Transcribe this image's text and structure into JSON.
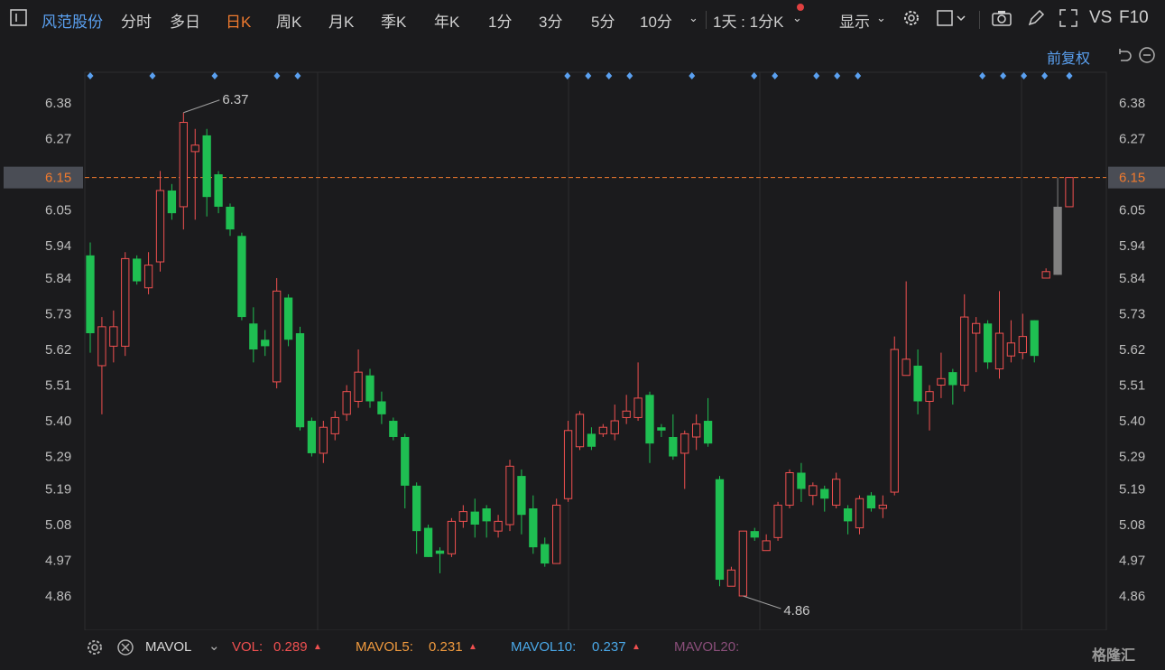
{
  "toolbar": {
    "stock_name": "风范股份",
    "periods": [
      "分时",
      "多日",
      "日K",
      "周K",
      "月K",
      "季K",
      "年K",
      "1分",
      "3分",
      "5分",
      "10分"
    ],
    "active_period": "日K",
    "multi_label": "1天 : 1分K",
    "display_label": "显示",
    "vs_label": "VS",
    "f10_label": "F10"
  },
  "adjust_label": "前复权",
  "colors": {
    "up": "#f05050",
    "down": "#1fbf52",
    "bg": "#1b1b1d",
    "grid": "#2c2c2e",
    "accent": "#f07a2e",
    "blue": "#5aa0f0"
  },
  "chart_data": {
    "type": "candlestick",
    "ylim": [
      4.8,
      6.44
    ],
    "yticks": [
      "6.38",
      "6.27",
      "6.15",
      "6.05",
      "5.94",
      "5.84",
      "5.73",
      "5.62",
      "5.51",
      "5.40",
      "5.29",
      "5.19",
      "5.08",
      "4.97",
      "4.86"
    ],
    "last_price": "6.15",
    "max_label": "6.37",
    "min_label": "4.86",
    "candles": [
      [
        5.91,
        5.67,
        5.95,
        5.61
      ],
      [
        5.57,
        5.69,
        5.72,
        5.42
      ],
      [
        5.63,
        5.69,
        5.74,
        5.58
      ],
      [
        5.63,
        5.9,
        5.92,
        5.6
      ],
      [
        5.9,
        5.83,
        5.91,
        5.82
      ],
      [
        5.81,
        5.88,
        5.92,
        5.79
      ],
      [
        5.89,
        6.11,
        6.17,
        5.86
      ],
      [
        6.11,
        6.04,
        6.13,
        6.02
      ],
      [
        6.06,
        6.32,
        6.35,
        5.99
      ],
      [
        6.23,
        6.25,
        6.3,
        6.02
      ],
      [
        6.28,
        6.09,
        6.3,
        6.03
      ],
      [
        6.16,
        6.06,
        6.17,
        6.04
      ],
      [
        6.06,
        5.99,
        6.07,
        5.97
      ],
      [
        5.97,
        5.72,
        5.98,
        5.71
      ],
      [
        5.7,
        5.62,
        5.75,
        5.58
      ],
      [
        5.65,
        5.63,
        5.68,
        5.6
      ],
      [
        5.52,
        5.8,
        5.84,
        5.5
      ],
      [
        5.78,
        5.65,
        5.79,
        5.63
      ],
      [
        5.67,
        5.38,
        5.69,
        5.37
      ],
      [
        5.4,
        5.3,
        5.41,
        5.29
      ],
      [
        5.3,
        5.38,
        5.4,
        5.27
      ],
      [
        5.36,
        5.41,
        5.43,
        5.34
      ],
      [
        5.42,
        5.49,
        5.51,
        5.4
      ],
      [
        5.46,
        5.55,
        5.62,
        5.44
      ],
      [
        5.54,
        5.46,
        5.56,
        5.44
      ],
      [
        5.46,
        5.42,
        5.49,
        5.39
      ],
      [
        5.4,
        5.35,
        5.41,
        5.34
      ],
      [
        5.35,
        5.2,
        5.36,
        5.13
      ],
      [
        5.2,
        5.06,
        5.21,
        4.99
      ],
      [
        5.07,
        4.98,
        5.08,
        4.98
      ],
      [
        5.0,
        4.99,
        5.01,
        4.93
      ],
      [
        4.99,
        5.09,
        5.1,
        4.98
      ],
      [
        5.09,
        5.12,
        5.14,
        5.07
      ],
      [
        5.12,
        5.08,
        5.16,
        5.04
      ],
      [
        5.13,
        5.09,
        5.14,
        5.04
      ],
      [
        5.06,
        5.09,
        5.11,
        5.04
      ],
      [
        5.08,
        5.26,
        5.28,
        5.06
      ],
      [
        5.23,
        5.11,
        5.25,
        5.05
      ],
      [
        5.13,
        5.01,
        5.17,
        4.99
      ],
      [
        5.02,
        4.96,
        5.04,
        4.95
      ],
      [
        4.96,
        5.14,
        5.16,
        4.96
      ],
      [
        5.16,
        5.37,
        5.4,
        5.15
      ],
      [
        5.32,
        5.42,
        5.43,
        5.31
      ],
      [
        5.36,
        5.32,
        5.38,
        5.31
      ],
      [
        5.36,
        5.38,
        5.39,
        5.35
      ],
      [
        5.36,
        5.4,
        5.45,
        5.34
      ],
      [
        5.41,
        5.43,
        5.48,
        5.39
      ],
      [
        5.41,
        5.47,
        5.58,
        5.4
      ],
      [
        5.48,
        5.33,
        5.49,
        5.27
      ],
      [
        5.38,
        5.37,
        5.39,
        5.35
      ],
      [
        5.35,
        5.29,
        5.42,
        5.28
      ],
      [
        5.3,
        5.36,
        5.37,
        5.19
      ],
      [
        5.35,
        5.39,
        5.42,
        5.31
      ],
      [
        5.4,
        5.33,
        5.47,
        5.32
      ],
      [
        5.22,
        4.91,
        5.23,
        4.89
      ],
      [
        4.89,
        4.94,
        4.95,
        4.89
      ],
      [
        4.86,
        5.06,
        5.06,
        4.86
      ],
      [
        5.06,
        5.04,
        5.07,
        5.03
      ],
      [
        5.0,
        5.03,
        5.05,
        5.0
      ],
      [
        5.04,
        5.14,
        5.15,
        5.03
      ],
      [
        5.14,
        5.24,
        5.25,
        5.13
      ],
      [
        5.24,
        5.19,
        5.27,
        5.15
      ],
      [
        5.17,
        5.2,
        5.21,
        5.14
      ],
      [
        5.19,
        5.16,
        5.2,
        5.12
      ],
      [
        5.14,
        5.22,
        5.24,
        5.13
      ],
      [
        5.13,
        5.09,
        5.14,
        5.05
      ],
      [
        5.07,
        5.16,
        5.17,
        5.05
      ],
      [
        5.17,
        5.13,
        5.18,
        5.12
      ],
      [
        5.13,
        5.14,
        5.17,
        5.1
      ],
      [
        5.18,
        5.62,
        5.66,
        5.17
      ],
      [
        5.54,
        5.59,
        5.83,
        5.54
      ],
      [
        5.57,
        5.46,
        5.62,
        5.42
      ],
      [
        5.46,
        5.49,
        5.51,
        5.37
      ],
      [
        5.51,
        5.53,
        5.61,
        5.47
      ],
      [
        5.55,
        5.51,
        5.56,
        5.45
      ],
      [
        5.51,
        5.72,
        5.79,
        5.49
      ],
      [
        5.67,
        5.7,
        5.72,
        5.55
      ],
      [
        5.7,
        5.58,
        5.71,
        5.56
      ],
      [
        5.56,
        5.67,
        5.8,
        5.53
      ],
      [
        5.6,
        5.64,
        5.71,
        5.58
      ],
      [
        5.61,
        5.66,
        5.73,
        5.59
      ],
      [
        5.71,
        5.6,
        5.71,
        5.58
      ],
      [
        5.84,
        5.86,
        5.87,
        5.84
      ],
      [
        5.85,
        6.06,
        6.15,
        5.85
      ],
      [
        6.06,
        6.15,
        6.15,
        6.06
      ]
    ],
    "markers": [
      0,
      3,
      6,
      10,
      11,
      22,
      23,
      24,
      25,
      28,
      32,
      33,
      35,
      36,
      37,
      52,
      53,
      54,
      55,
      56,
      57
    ]
  },
  "sub_legend": {
    "mavol": "MAVOL",
    "vol_label": "VOL:",
    "vol_value": "0.289",
    "mavol5_label": "MAVOL5:",
    "mavol5_value": "0.231",
    "mavol10_label": "MAVOL10:",
    "mavol10_value": "0.237",
    "mavol20_label": "MAVOL20:"
  },
  "watermark": "格隆汇"
}
